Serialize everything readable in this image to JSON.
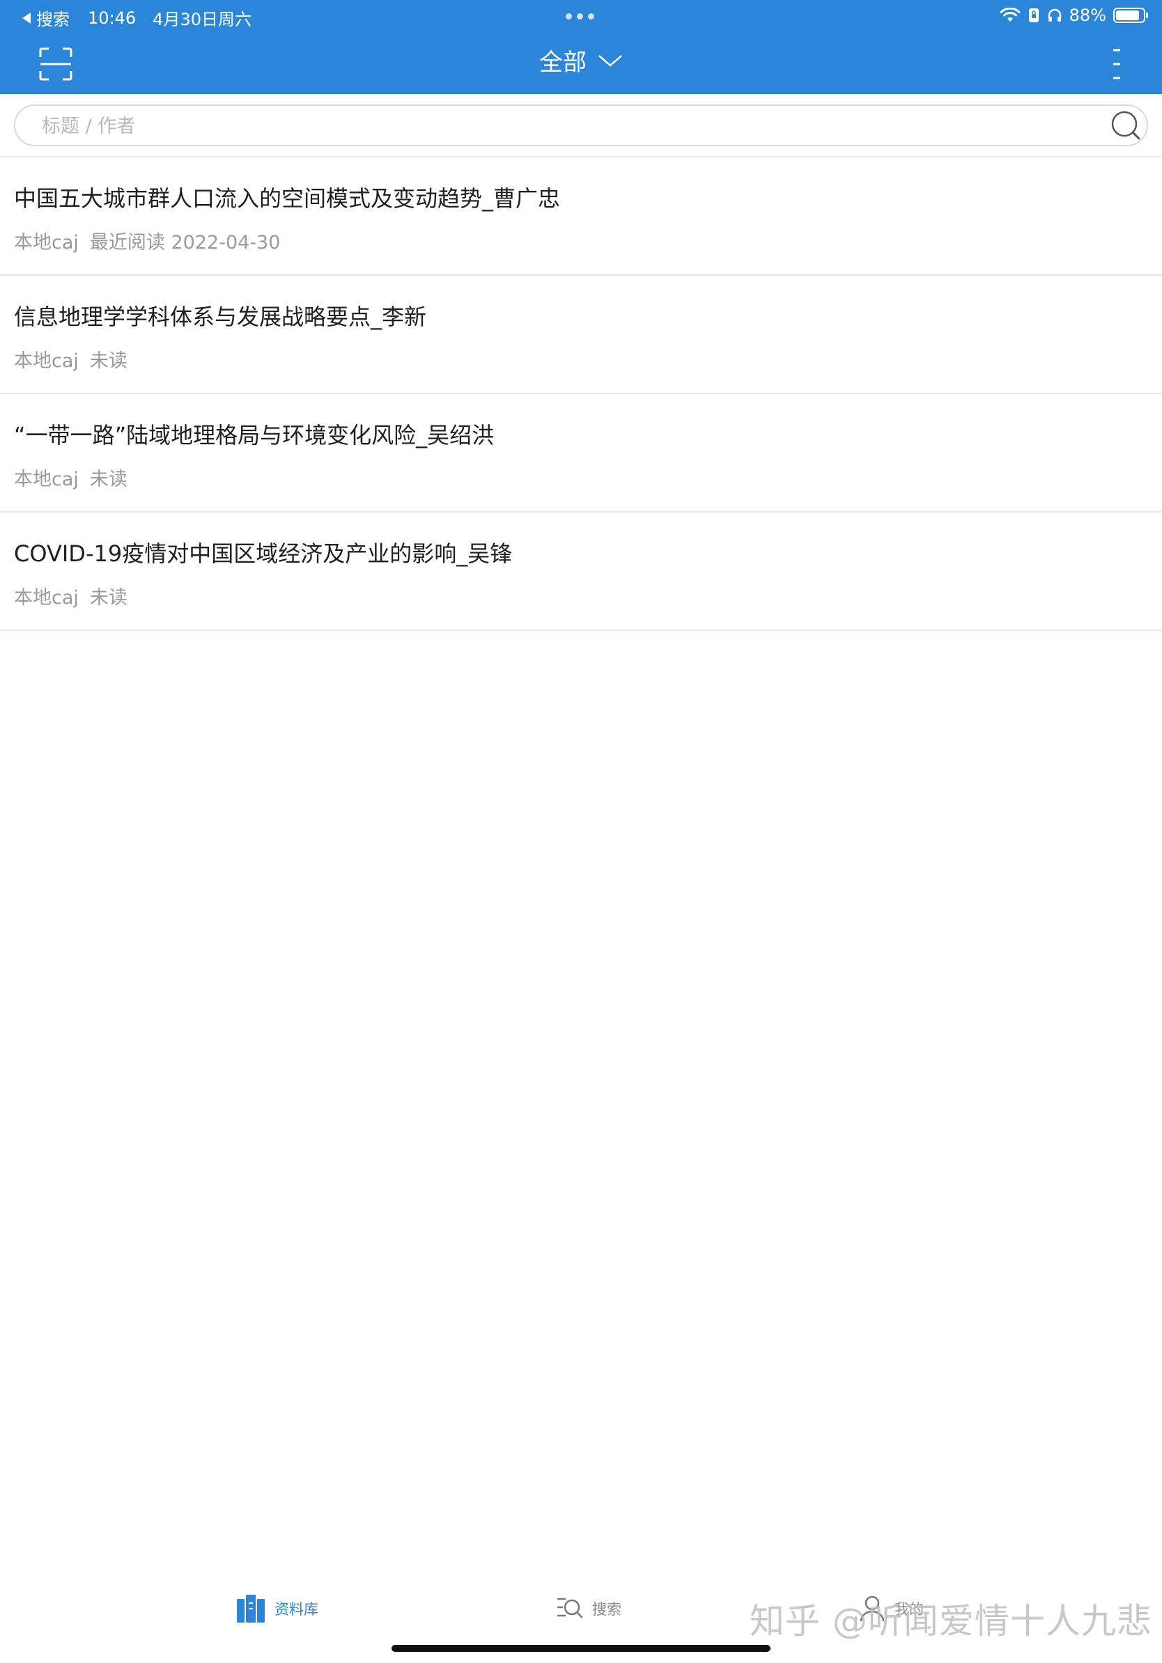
{
  "status_bar": {
    "back_label": "搜索",
    "time": "10:46",
    "date": "4月30日周六",
    "battery_percent": "88%",
    "battery_level": 0.88
  },
  "header": {
    "title": "全部"
  },
  "search": {
    "placeholder": "标题 / 作者",
    "value": ""
  },
  "documents": [
    {
      "title": "中国五大城市群人口流入的空间模式及变动趋势_曹广忠",
      "source": "本地caj",
      "status": "最近阅读 2022-04-30"
    },
    {
      "title": "信息地理学学科体系与发展战略要点_李新",
      "source": "本地caj",
      "status": "未读"
    },
    {
      "title": "“一带一路”陆域地理格局与环境变化风险_吴绍洪",
      "source": "本地caj",
      "status": "未读"
    },
    {
      "title": "COVID-19疫情对中国区域经济及产业的影响_吴锋",
      "source": "本地caj",
      "status": "未读"
    }
  ],
  "tabbar": {
    "library": "资料库",
    "search": "搜索",
    "mine": "我的"
  },
  "watermark": "知乎 @听闻爱情十人九悲",
  "colors": {
    "accent": "#2b86d9"
  }
}
